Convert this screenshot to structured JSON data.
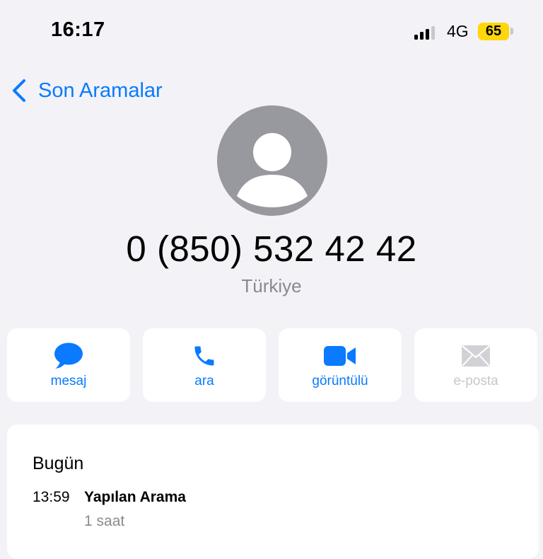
{
  "status_bar": {
    "time": "16:17",
    "network": "4G",
    "battery": "65",
    "battery_color": "#ffd60a"
  },
  "nav": {
    "back_label": "Son Aramalar",
    "accent_color": "#0a7aff"
  },
  "contact": {
    "avatar_icon": "person-placeholder-icon",
    "number": "0 (850) 532 42 42",
    "country": "Türkiye"
  },
  "actions": [
    {
      "label": "mesaj",
      "icon": "message-bubble-icon",
      "enabled": true
    },
    {
      "label": "ara",
      "icon": "phone-icon",
      "enabled": true
    },
    {
      "label": "görüntülü",
      "icon": "video-camera-icon",
      "enabled": true
    },
    {
      "label": "e-posta",
      "icon": "envelope-icon",
      "enabled": false
    }
  ],
  "recents": {
    "section_title": "Bugün",
    "entries": [
      {
        "time": "13:59",
        "type": "Yapılan Arama",
        "ago": "1 saat"
      }
    ]
  }
}
